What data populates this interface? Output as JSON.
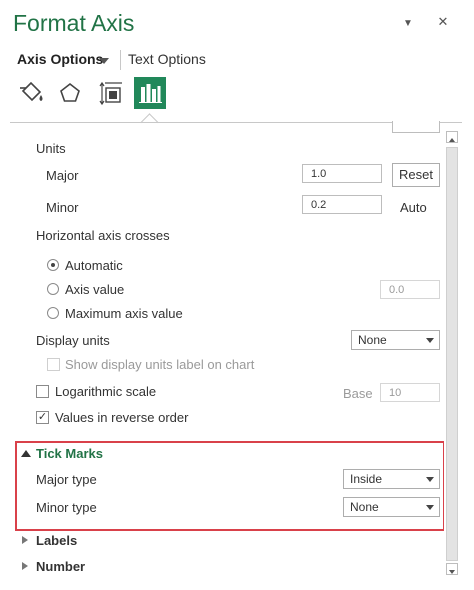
{
  "header": {
    "title": "Format Axis",
    "dropdown_glyph": "▼",
    "close_glyph": "✕"
  },
  "tabs": {
    "axis_options": "Axis Options",
    "text_options": "Text Options"
  },
  "icons": [
    "fill-line-icon",
    "effects-icon",
    "size-properties-icon",
    "axis-options-icon"
  ],
  "accent_color": "#217346",
  "units": {
    "heading": "Units",
    "major_label": "Major",
    "major_value": "1.0",
    "reset_label": "Reset",
    "minor_label": "Minor",
    "minor_value": "0.2",
    "auto_label": "Auto"
  },
  "crosses": {
    "heading": "Horizontal axis crosses",
    "automatic": "Automatic",
    "axis_value": "Axis value",
    "axis_value_input": "0.0",
    "maximum": "Maximum axis value"
  },
  "display_units": {
    "label": "Display units",
    "value": "None",
    "show_label": "Show display units label on chart"
  },
  "log_scale": {
    "label": "Logarithmic scale",
    "base_label": "Base",
    "base_value": "10"
  },
  "reverse": {
    "label": "Values in reverse order",
    "check": "✓"
  },
  "tick_marks": {
    "heading": "Tick Marks",
    "major_label": "Major type",
    "major_value": "Inside",
    "minor_label": "Minor type",
    "minor_value": "None"
  },
  "sections": {
    "labels": "Labels",
    "number": "Number"
  }
}
